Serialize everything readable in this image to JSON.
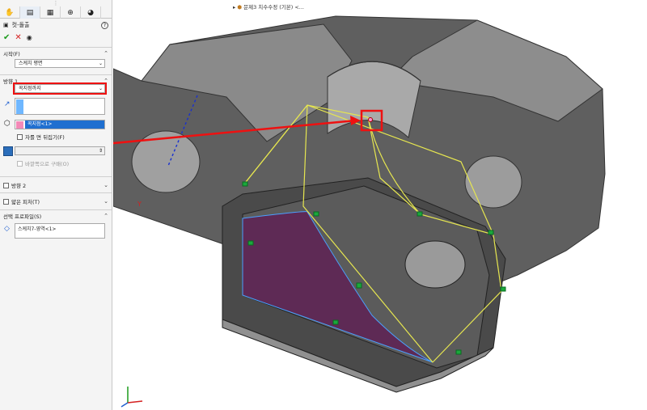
{
  "panel": {
    "tabs": [
      "feature-manager-icon",
      "property-manager-icon",
      "config-manager-icon",
      "dim-expert-icon",
      "display-manager-icon"
    ],
    "title": "컷-돌출",
    "help": "?",
    "ok": "✔",
    "cancel": "✕",
    "preview": "◉",
    "start": {
      "label": "시작(F)",
      "value": "스케치 평면"
    },
    "direction1": {
      "label": "방향 1",
      "end_condition": "꼭지점까지",
      "vertex_value": "꼭지점<1>",
      "flip_side": "자를 면 뒤집기(F)",
      "draft_outward": "바깥쪽으로 구배(O)"
    },
    "direction2": {
      "label": "방향 2"
    },
    "thin": {
      "label": "얇은 피처(T)"
    },
    "selected": {
      "label": "선택 프로파일(S)",
      "value": "스케치7-영역<1>"
    }
  },
  "viewport": {
    "breadcrumb": "문제3 치수수정 (기본) <...",
    "colors": {
      "part": "#5f5f5f",
      "cut_face": "#5e2a55",
      "preview": "#e6e650",
      "arrow": "#e11"
    }
  }
}
